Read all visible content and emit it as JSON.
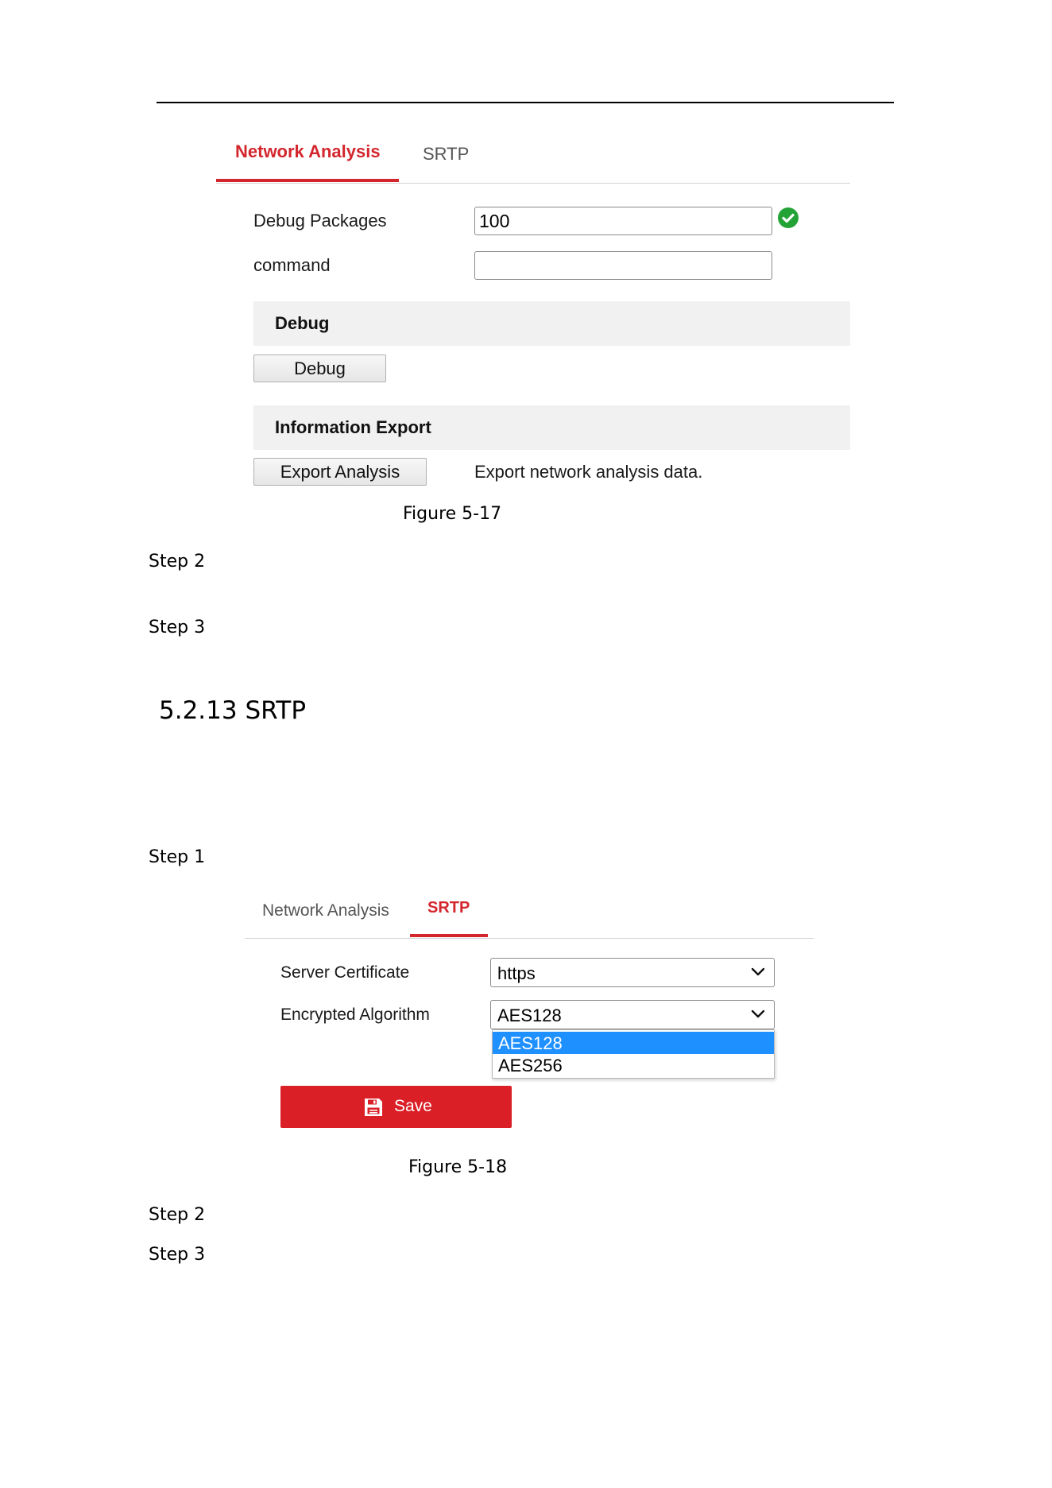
{
  "figure_17": {
    "tabs": [
      {
        "label": "Network Analysis",
        "active": true
      },
      {
        "label": "SRTP",
        "active": false
      }
    ],
    "debug_packages": {
      "label": "Debug Packages",
      "value": "100"
    },
    "command": {
      "label": "command",
      "value": ""
    },
    "debug_section": {
      "title": "Debug",
      "button_label": "Debug"
    },
    "export_section": {
      "title": "Information Export",
      "button_label": "Export Analysis",
      "description": "Export network analysis data."
    },
    "caption": "Figure 5-17"
  },
  "steps_a": [
    "Step 2",
    "Step 3"
  ],
  "heading": "5.2.13 SRTP",
  "step_b": "Step 1",
  "figure_18": {
    "tabs": [
      {
        "label": "Network Analysis",
        "active": false
      },
      {
        "label": "SRTP",
        "active": true
      }
    ],
    "server_certificate": {
      "label": "Server Certificate",
      "value": "https"
    },
    "encrypted_algorithm": {
      "label": "Encrypted Algorithm",
      "value": "AES128",
      "options": [
        "AES128",
        "AES256"
      ],
      "highlighted": "AES128"
    },
    "save_label": "Save",
    "caption": "Figure 5-18"
  },
  "steps_c": [
    "Step 2",
    "Step 3"
  ],
  "colors": {
    "accent": "#d3262d",
    "save_button": "#da1f26",
    "selected_option": "#1e90ff",
    "ok_icon": "#23a336"
  },
  "icons": [
    "check-circle-icon",
    "chevron-down-icon",
    "floppy-disk-icon"
  ]
}
